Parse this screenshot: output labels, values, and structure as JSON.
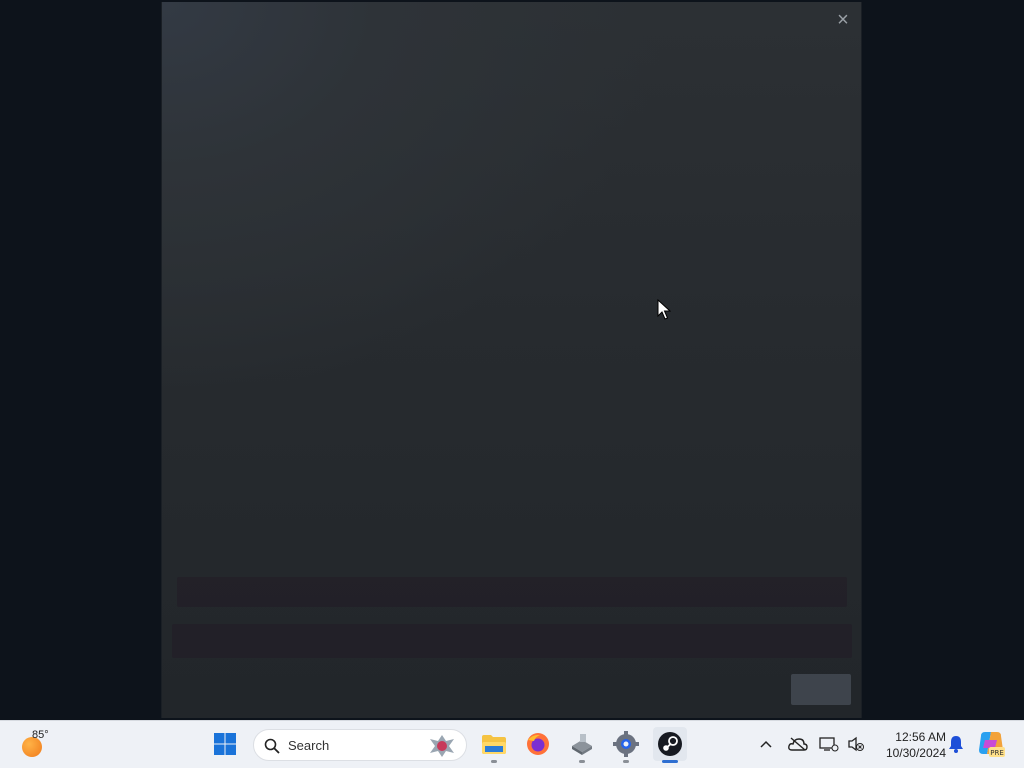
{
  "dialog": {
    "close_glyph": "×",
    "button_label": ""
  },
  "taskbar": {
    "weather": {
      "temp": "85°",
      "icon": "weather-sun-icon"
    },
    "search": {
      "label": "Search"
    },
    "apps": [
      {
        "name": "start-button",
        "icon": "windows-logo-icon"
      },
      {
        "name": "file-explorer",
        "icon": "folder-icon"
      },
      {
        "name": "firefox",
        "icon": "firefox-icon"
      },
      {
        "name": "disk-tool",
        "icon": "drive-icon"
      },
      {
        "name": "settings",
        "icon": "gear-icon"
      },
      {
        "name": "steam",
        "icon": "steam-icon"
      }
    ],
    "clock": {
      "time": "12:56 AM",
      "date": "10/30/2024"
    },
    "copilot_badge": "PRE"
  }
}
